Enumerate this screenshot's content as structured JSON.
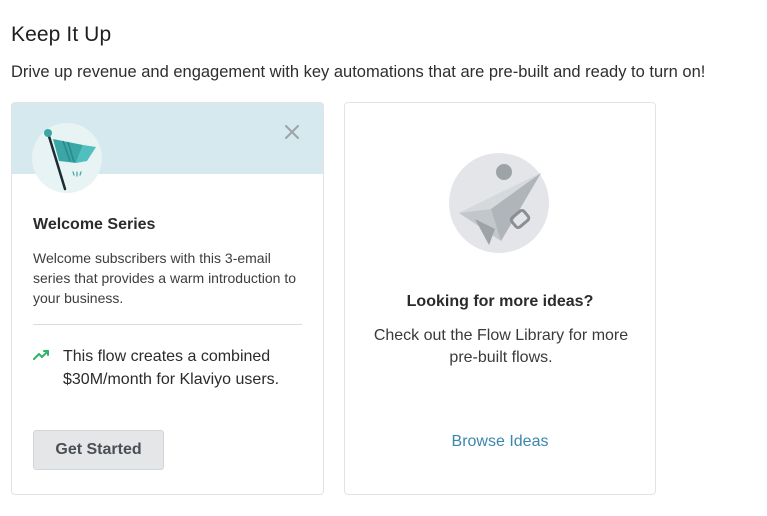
{
  "section": {
    "title": "Keep It Up",
    "subtitle": "Drive up revenue and engagement with key automations that are pre-built and ready to turn on!"
  },
  "welcome_card": {
    "badge_icon": "flag-icon",
    "close_icon": "close-icon",
    "title": "Welcome Series",
    "description": "Welcome subscribers with this 3-email series that provides a warm introduction to your business.",
    "stat_icon": "trending-up-icon",
    "stat_text": "This flow creates a combined $30M/month for Klaviyo users.",
    "button_label": "Get Started"
  },
  "ideas_card": {
    "illustration_icon": "paper-plane-icon",
    "title": "Looking for more ideas?",
    "description": "Check out the Flow Library for more pre-built flows.",
    "link_label": "Browse Ideas"
  },
  "colors": {
    "header_bg": "#d6e9ee",
    "accent_teal": "#3aa6a6",
    "link_blue": "#3a87ad",
    "button_bg": "#e4e6e8",
    "trend_green": "#2fb36b"
  }
}
